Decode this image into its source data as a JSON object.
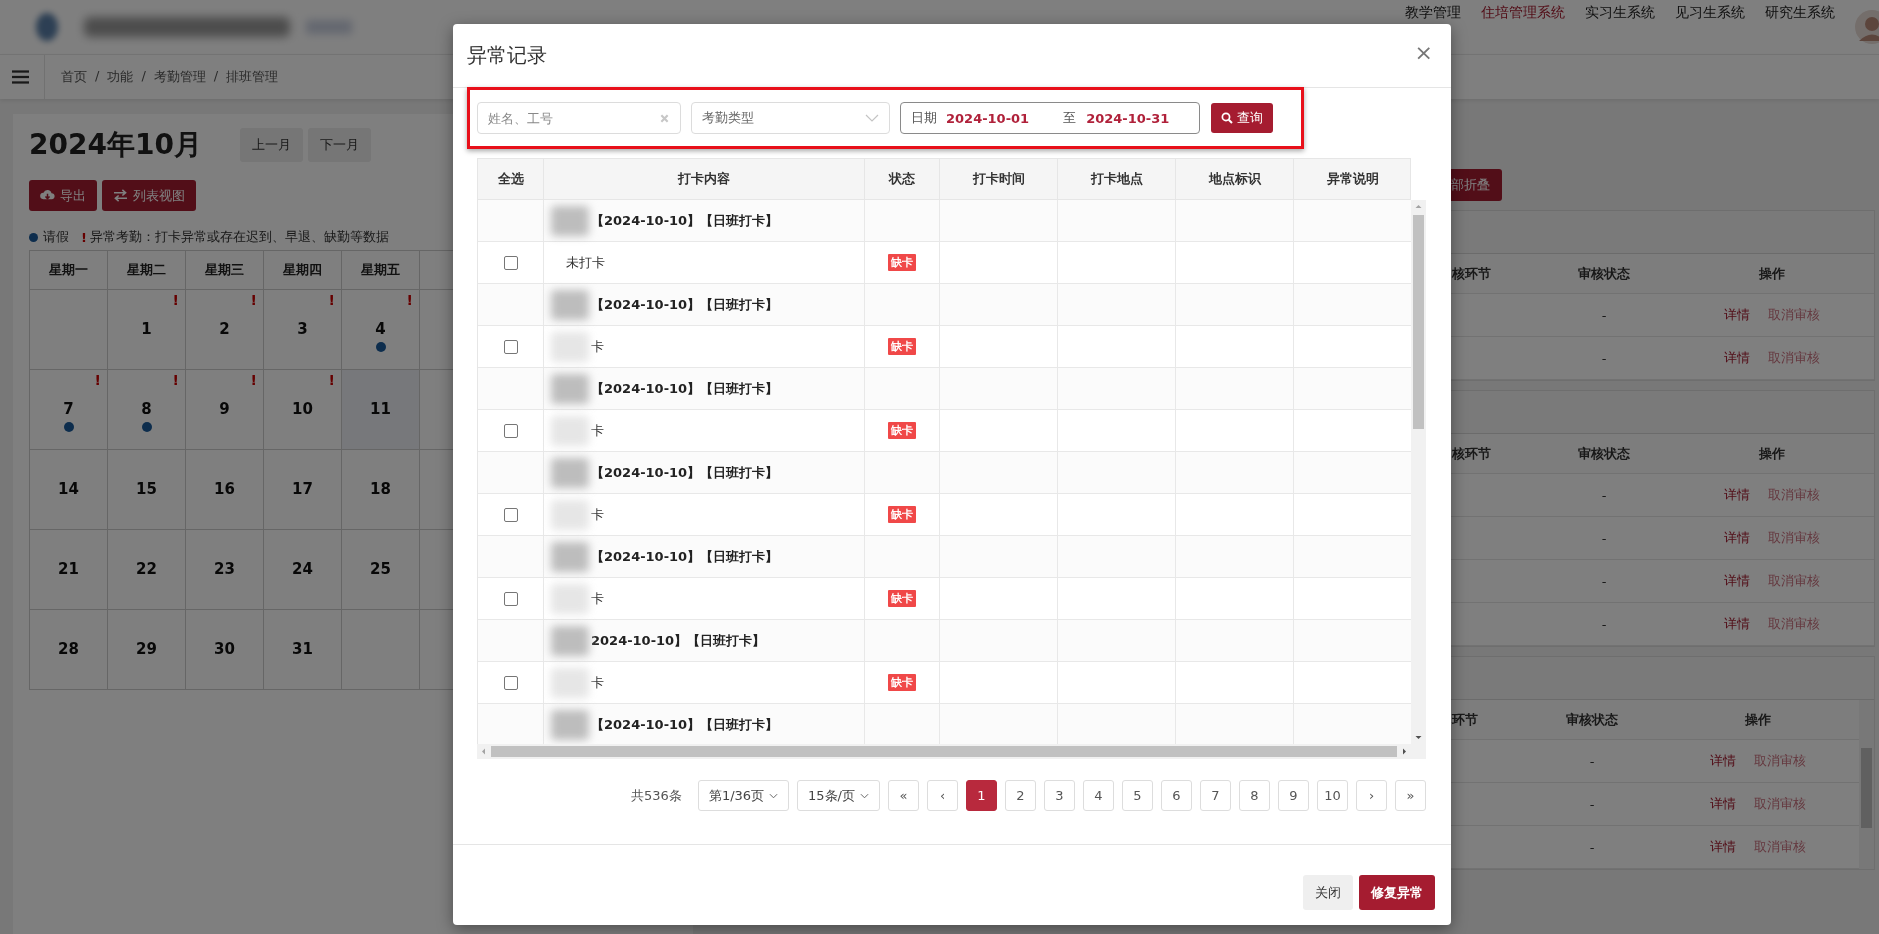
{
  "header": {
    "nav": [
      {
        "label": "教学管理",
        "selected": false
      },
      {
        "label": "住培管理系统",
        "selected": true
      },
      {
        "label": "实习生系统",
        "selected": false
      },
      {
        "label": "见习生系统",
        "selected": false
      },
      {
        "label": "研究生系统",
        "selected": false
      }
    ]
  },
  "breadcrumb": [
    "首页",
    "/",
    "功能",
    "/",
    "考勤管理",
    "/",
    "排班管理"
  ],
  "calendar": {
    "title": "2024年10月",
    "nav_buttons": [
      "上一月",
      "下一月"
    ],
    "actions": [
      {
        "label": "导出",
        "kind": "download"
      },
      {
        "label": "列表视图",
        "kind": "swap"
      }
    ],
    "legend": [
      {
        "kind": "dot",
        "label": "请假"
      },
      {
        "kind": "alert",
        "mark": "!",
        "label": "异常考勤：打卡异常或存在迟到、早退、缺勤等数据"
      }
    ],
    "weekdays": [
      "星期一",
      "星期二",
      "星期三",
      "星期四",
      "星期五"
    ],
    "weeks": [
      [
        {
          "kind": "empty"
        },
        {
          "kind": "day",
          "day": "1",
          "alert": "!",
          "leave": false,
          "today": false
        },
        {
          "kind": "day",
          "day": "2",
          "alert": "!",
          "leave": false,
          "today": false
        },
        {
          "kind": "day",
          "day": "3",
          "alert": "!",
          "leave": false,
          "today": false
        },
        {
          "kind": "day",
          "day": "4",
          "alert": "!",
          "leave": true,
          "today": false
        }
      ],
      [
        {
          "kind": "day",
          "day": "7",
          "alert": "!",
          "leave": true,
          "today": false
        },
        {
          "kind": "day",
          "day": "8",
          "alert": "!",
          "leave": true,
          "today": false
        },
        {
          "kind": "day",
          "day": "9",
          "alert": "!",
          "leave": false,
          "today": false
        },
        {
          "kind": "day",
          "day": "10",
          "alert": "!",
          "leave": false,
          "today": false
        },
        {
          "kind": "day",
          "day": "11",
          "leave": false,
          "today": true
        }
      ],
      [
        {
          "kind": "day",
          "day": "14",
          "leave": false,
          "today": false
        },
        {
          "kind": "day",
          "day": "15",
          "leave": false,
          "today": false
        },
        {
          "kind": "day",
          "day": "16",
          "leave": false,
          "today": false
        },
        {
          "kind": "day",
          "day": "17",
          "leave": false,
          "today": false
        },
        {
          "kind": "day",
          "day": "18",
          "leave": false,
          "today": false
        }
      ],
      [
        {
          "kind": "day",
          "day": "21",
          "leave": false,
          "today": false
        },
        {
          "kind": "day",
          "day": "22",
          "leave": false,
          "today": false
        },
        {
          "kind": "day",
          "day": "23",
          "leave": false,
          "today": false
        },
        {
          "kind": "day",
          "day": "24",
          "leave": false,
          "today": false
        },
        {
          "kind": "day",
          "day": "25",
          "leave": false,
          "today": false
        }
      ],
      [
        {
          "kind": "day",
          "day": "28",
          "leave": false,
          "today": false
        },
        {
          "kind": "day",
          "day": "29",
          "leave": false,
          "today": false
        },
        {
          "kind": "day",
          "day": "30",
          "leave": false,
          "today": false
        },
        {
          "kind": "day",
          "day": "31",
          "leave": false,
          "today": false
        },
        {
          "kind": "empty"
        }
      ]
    ]
  },
  "collapse_button": "部折叠",
  "review_panels": [
    {
      "scrollbar": false,
      "columns": [
        "核环节",
        "审核状态",
        "操作"
      ],
      "rows": [
        {
          "status": "-",
          "actions": [
            "详情",
            "取消审核"
          ]
        },
        {
          "status": "-",
          "actions": [
            "详情",
            "取消审核"
          ]
        }
      ]
    },
    {
      "scrollbar": false,
      "columns": [
        "核环节",
        "审核状态",
        "操作"
      ],
      "rows": [
        {
          "status": "-",
          "actions": [
            "详情",
            "取消审核"
          ]
        },
        {
          "status": "-",
          "actions": [
            "详情",
            "取消审核"
          ]
        },
        {
          "status": "-",
          "actions": [
            "详情",
            "取消审核"
          ]
        },
        {
          "status": "-",
          "actions": [
            "详情",
            "取消审核"
          ]
        }
      ]
    },
    {
      "scrollbar": true,
      "columns": [
        "环节",
        "审核状态",
        "操作"
      ],
      "rows": [
        {
          "status": "-",
          "actions": [
            "详情",
            "取消审核"
          ]
        },
        {
          "status": "-",
          "actions": [
            "详情",
            "取消审核"
          ]
        },
        {
          "status": "-",
          "actions": [
            "详情",
            "取消审核"
          ]
        }
      ]
    }
  ],
  "modal": {
    "title": "异常记录",
    "close": "×",
    "filters": {
      "name_placeholder": "姓名、工号",
      "type_placeholder": "考勤类型",
      "date_label": "日期",
      "date_from": "2024-10-01",
      "date_sep": "至",
      "date_to": "2024-10-31",
      "query": "查询"
    },
    "table": {
      "columns": [
        "全选",
        "打卡内容",
        "状态",
        "打卡时间",
        "打卡地点",
        "地点标识",
        "异常说明"
      ],
      "rows": [
        {
          "kind": "group",
          "label": "【2024-10-10】【日班打卡】",
          "redacted": true
        },
        {
          "kind": "record",
          "checked": false,
          "label": "未打卡",
          "redacted": false,
          "status": "缺卡"
        },
        {
          "kind": "group",
          "label": "【2024-10-10】【日班打卡】",
          "redacted": true
        },
        {
          "kind": "record",
          "checked": false,
          "label": "卡",
          "redacted": true,
          "status": "缺卡"
        },
        {
          "kind": "group",
          "label": "【2024-10-10】【日班打卡】",
          "redacted": true
        },
        {
          "kind": "record",
          "checked": false,
          "label": "卡",
          "redacted": true,
          "status": "缺卡"
        },
        {
          "kind": "group",
          "label": "【2024-10-10】【日班打卡】",
          "redacted": true
        },
        {
          "kind": "record",
          "checked": false,
          "label": "卡",
          "redacted": true,
          "status": "缺卡"
        },
        {
          "kind": "group",
          "label": "【2024-10-10】【日班打卡】",
          "redacted": true
        },
        {
          "kind": "record",
          "checked": false,
          "label": "卡",
          "redacted": true,
          "status": "缺卡"
        },
        {
          "kind": "group",
          "label": "2024-10-10】【日班打卡】",
          "redacted": true
        },
        {
          "kind": "record",
          "checked": false,
          "label": "卡",
          "redacted": true,
          "status": "缺卡"
        },
        {
          "kind": "group",
          "label": "【2024-10-10】【日班打卡】",
          "redacted": true
        }
      ]
    },
    "pagination": {
      "total": "共536条",
      "page_select": "第1/36页",
      "size_select": "15条/页",
      "pages": [
        {
          "label": "«",
          "selected": false
        },
        {
          "label": "‹",
          "selected": false
        },
        {
          "label": "1",
          "selected": true
        },
        {
          "label": "2",
          "selected": false
        },
        {
          "label": "3",
          "selected": false
        },
        {
          "label": "4",
          "selected": false
        },
        {
          "label": "5",
          "selected": false
        },
        {
          "label": "6",
          "selected": false
        },
        {
          "label": "7",
          "selected": false
        },
        {
          "label": "8",
          "selected": false
        },
        {
          "label": "9",
          "selected": false
        },
        {
          "label": "10",
          "selected": false
        },
        {
          "label": "›",
          "selected": false
        },
        {
          "label": "»",
          "selected": false
        }
      ]
    },
    "buttons": [
      {
        "label": "关闭",
        "kind": "default"
      },
      {
        "label": "修复异常",
        "kind": "primary"
      }
    ]
  }
}
